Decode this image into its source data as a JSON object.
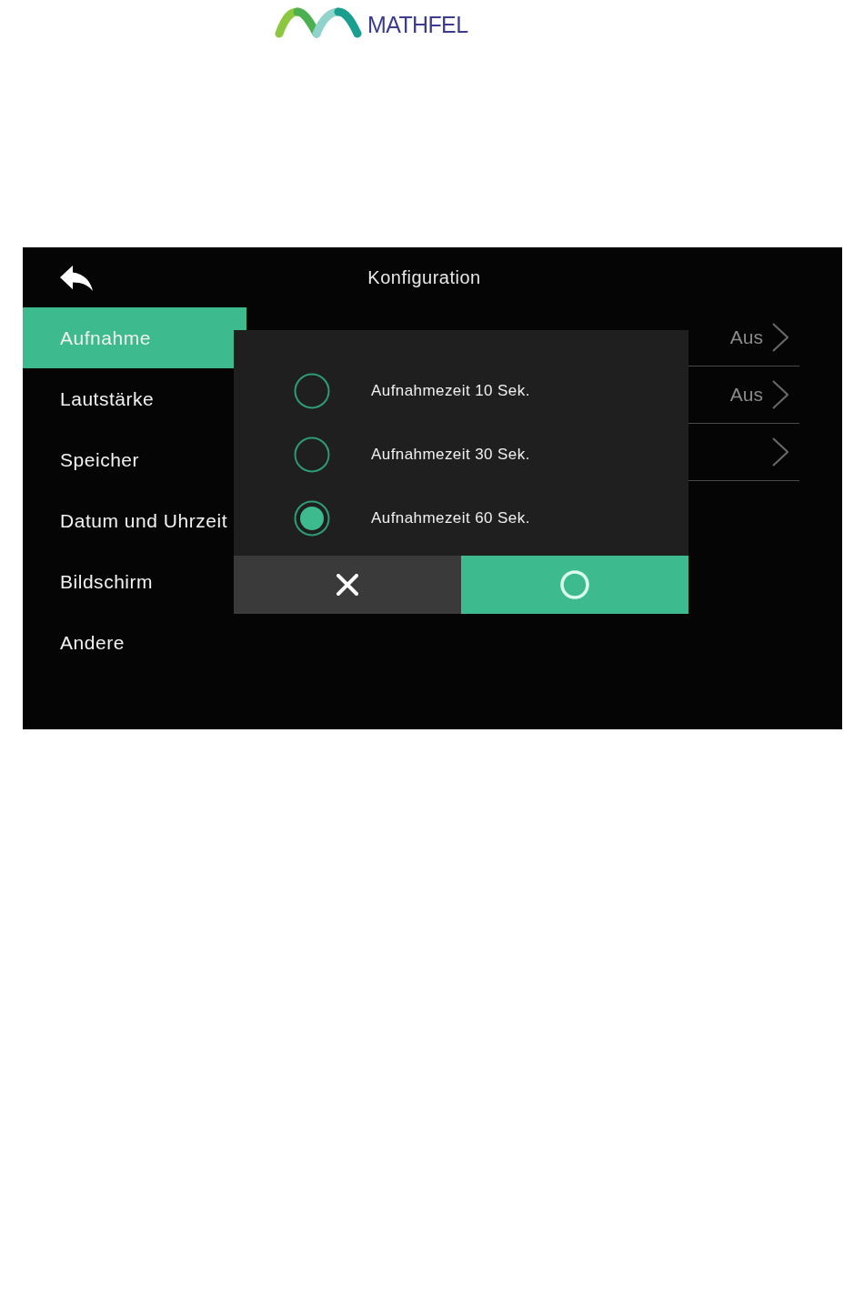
{
  "logo": {
    "text": "MATHFEL"
  },
  "screen": {
    "title": "Konfiguration"
  },
  "sidebar": {
    "items": [
      {
        "label": "Aufnahme",
        "selected": true
      },
      {
        "label": "Lautstärke",
        "selected": false
      },
      {
        "label": "Speicher",
        "selected": false
      },
      {
        "label": "Datum und Uhrzeit",
        "selected": false
      },
      {
        "label": "Bildschirm",
        "selected": false
      },
      {
        "label": "Andere",
        "selected": false
      }
    ]
  },
  "settings_rows": [
    {
      "kind": "value",
      "value": "Aus"
    },
    {
      "kind": "value",
      "value": "Aus"
    },
    {
      "kind": "link"
    }
  ],
  "dialog": {
    "options": [
      {
        "label": "Aufnahmezeit 10 Sek.",
        "selected": false
      },
      {
        "label": "Aufnahmezeit 30 Sek.",
        "selected": false
      },
      {
        "label": "Aufnahmezeit 60 Sek.",
        "selected": true
      }
    ],
    "buttons": [
      {
        "kind": "cancel"
      },
      {
        "kind": "confirm"
      }
    ]
  }
}
